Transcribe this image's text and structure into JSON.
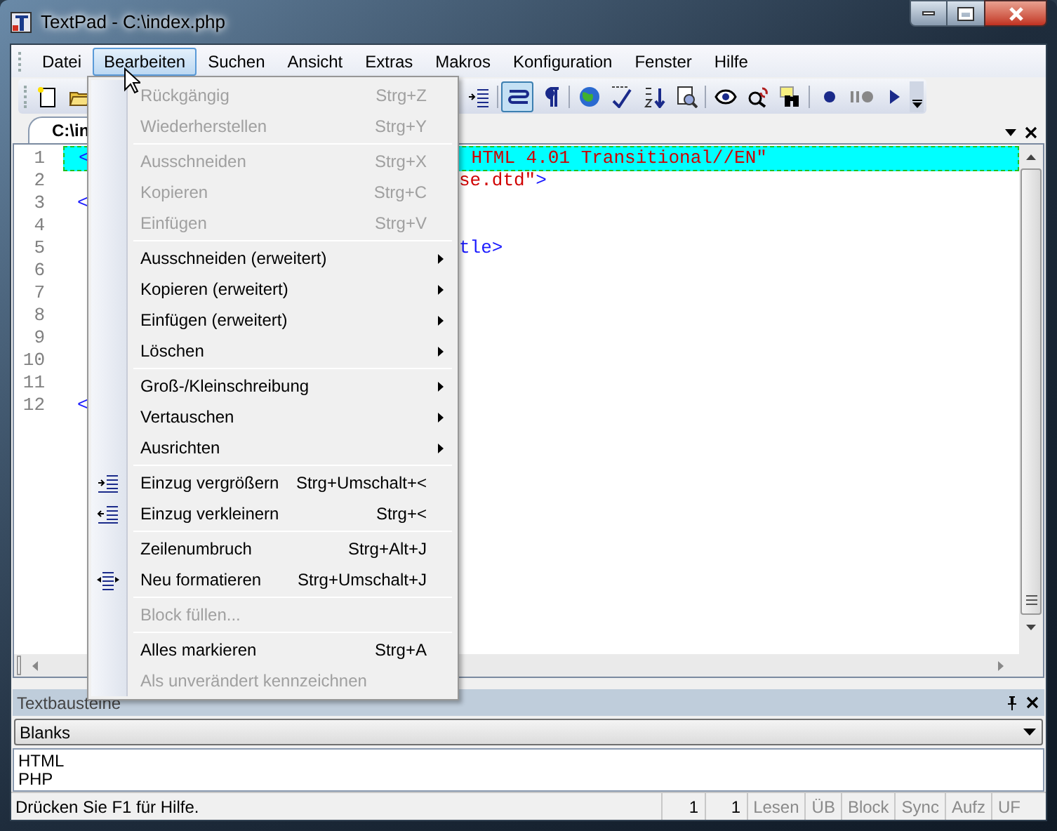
{
  "window": {
    "title": "TextPad - C:\\index.php"
  },
  "menubar": [
    {
      "label": "Datei",
      "selected": false
    },
    {
      "label": "Bearbeiten",
      "selected": true
    },
    {
      "label": "Suchen",
      "selected": false
    },
    {
      "label": "Ansicht",
      "selected": false
    },
    {
      "label": "Extras",
      "selected": false
    },
    {
      "label": "Makros",
      "selected": false
    },
    {
      "label": "Konfiguration",
      "selected": false
    },
    {
      "label": "Fenster",
      "selected": false
    },
    {
      "label": "Hilfe",
      "selected": false
    }
  ],
  "toolbar": {
    "buttons": [
      {
        "selected": false
      },
      {
        "selected": false
      },
      {
        "selected": false
      },
      {
        "selected": true
      },
      {
        "selected": false
      },
      {
        "selected": false
      },
      {
        "selected": false
      },
      {
        "selected": false
      },
      {
        "selected": false
      },
      {
        "selected": false
      },
      {
        "selected": false
      },
      {
        "selected": false
      },
      {
        "selected": false
      },
      {
        "selected": false
      },
      {
        "selected": false
      }
    ]
  },
  "document_tab": {
    "label": "C:\\in",
    "selected": true
  },
  "editor": {
    "lines": [
      {
        "number": "1",
        "highlighted": true,
        "left": [
          {
            "kind": "tag",
            "text": "<"
          }
        ],
        "right": [
          {
            "kind": "string",
            "text": " HTML 4.01 Transitional//EN\""
          }
        ]
      },
      {
        "number": "2",
        "highlighted": false,
        "right": [
          {
            "kind": "string",
            "text": "se.dtd\""
          },
          {
            "kind": "tag",
            "text": ">"
          }
        ]
      },
      {
        "number": "3",
        "highlighted": false,
        "left": [
          {
            "kind": "tag",
            "text": "<"
          }
        ]
      },
      {
        "number": "4",
        "highlighted": false
      },
      {
        "number": "5",
        "highlighted": false,
        "right": [
          {
            "kind": "tag",
            "text": "tle>"
          }
        ]
      },
      {
        "number": "6",
        "highlighted": false
      },
      {
        "number": "7",
        "highlighted": false
      },
      {
        "number": "8",
        "highlighted": false
      },
      {
        "number": "9",
        "highlighted": false
      },
      {
        "number": "10",
        "highlighted": false
      },
      {
        "number": "11",
        "highlighted": false
      },
      {
        "number": "12",
        "highlighted": false,
        "left": [
          {
            "kind": "tag",
            "text": "<"
          }
        ]
      }
    ]
  },
  "edit_menu": {
    "items": [
      {
        "kind": "item",
        "label": "Rückgängig",
        "shortcut": "Strg+Z",
        "disabled": true,
        "submenu": false
      },
      {
        "kind": "item",
        "label": "Wiederherstellen",
        "shortcut": "Strg+Y",
        "disabled": true,
        "submenu": false
      },
      {
        "kind": "separator"
      },
      {
        "kind": "item",
        "label": "Ausschneiden",
        "shortcut": "Strg+X",
        "disabled": true,
        "submenu": false
      },
      {
        "kind": "item",
        "label": "Kopieren",
        "shortcut": "Strg+C",
        "disabled": true,
        "submenu": false
      },
      {
        "kind": "item",
        "label": "Einfügen",
        "shortcut": "Strg+V",
        "disabled": true,
        "submenu": false
      },
      {
        "kind": "separator"
      },
      {
        "kind": "item",
        "label": "Ausschneiden (erweitert)",
        "disabled": false,
        "submenu": true
      },
      {
        "kind": "item",
        "label": "Kopieren (erweitert)",
        "disabled": false,
        "submenu": true
      },
      {
        "kind": "item",
        "label": "Einfügen (erweitert)",
        "disabled": false,
        "submenu": true
      },
      {
        "kind": "item",
        "label": "Löschen",
        "disabled": false,
        "submenu": true
      },
      {
        "kind": "separator"
      },
      {
        "kind": "item",
        "label": "Groß-/Kleinschreibung",
        "disabled": false,
        "submenu": true
      },
      {
        "kind": "item",
        "label": "Vertauschen",
        "disabled": false,
        "submenu": true
      },
      {
        "kind": "item",
        "label": "Ausrichten",
        "disabled": false,
        "submenu": true
      },
      {
        "kind": "separator"
      },
      {
        "kind": "item",
        "label": "Einzug vergrößern",
        "shortcut": "Strg+Umschalt+<",
        "disabled": false,
        "submenu": false
      },
      {
        "kind": "item",
        "label": "Einzug verkleinern",
        "shortcut": "Strg+<",
        "disabled": false,
        "submenu": false
      },
      {
        "kind": "separator"
      },
      {
        "kind": "item",
        "label": "Zeilenumbruch",
        "shortcut": "Strg+Alt+J",
        "disabled": false,
        "submenu": false
      },
      {
        "kind": "item",
        "label": "Neu formatieren",
        "shortcut": "Strg+Umschalt+J",
        "disabled": false,
        "submenu": false
      },
      {
        "kind": "separator"
      },
      {
        "kind": "item",
        "label": "Block füllen...",
        "disabled": true,
        "submenu": false
      },
      {
        "kind": "separator"
      },
      {
        "kind": "item",
        "label": "Alles markieren",
        "shortcut": "Strg+A",
        "disabled": false,
        "submenu": false
      },
      {
        "kind": "item",
        "label": "Als unverändert kennzeichnen",
        "disabled": true,
        "submenu": false
      }
    ]
  },
  "clip_panel": {
    "title": "Textbausteine",
    "library": "Blanks",
    "entries": [
      "HTML",
      "PHP"
    ]
  },
  "status_bar": {
    "message": "Drücken Sie F1 für Hilfe.",
    "line": "1",
    "column": "1",
    "indicators": [
      {
        "label": "Lesen",
        "on": false
      },
      {
        "label": "ÜB",
        "on": false
      },
      {
        "label": "Block",
        "on": false
      },
      {
        "label": "Sync",
        "on": false
      },
      {
        "label": "Aufz",
        "on": false
      },
      {
        "label": "UF",
        "on": false
      }
    ]
  }
}
